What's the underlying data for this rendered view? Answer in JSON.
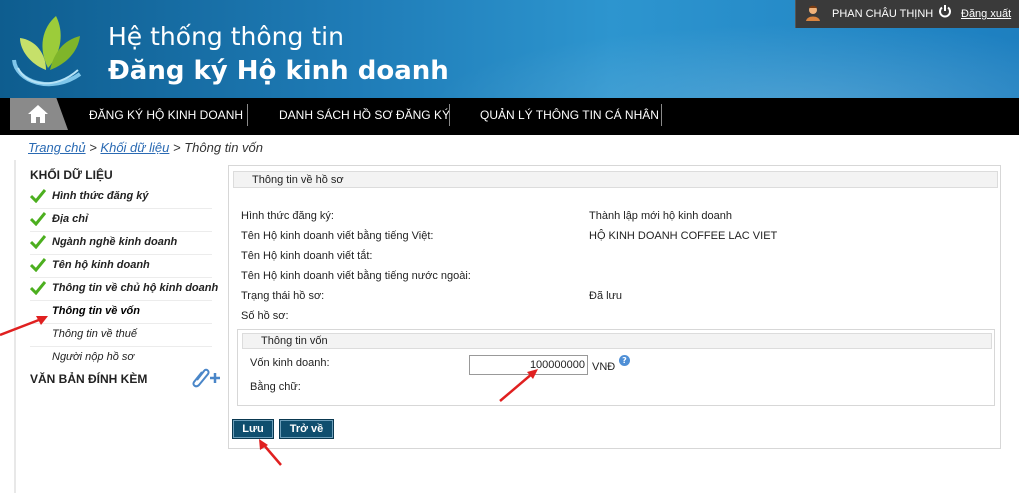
{
  "header": {
    "title_line1": "Hệ thống thông tin",
    "title_line2": "Đăng ký Hộ kinh doanh"
  },
  "user": {
    "name": "PHAN CHÂU THỊNH",
    "logout_label": "Đăng xuất"
  },
  "nav": {
    "items": [
      {
        "label": "ĐĂNG KÝ HỘ KINH DOANH"
      },
      {
        "label": "DANH SÁCH HỒ SƠ ĐĂNG KÝ"
      },
      {
        "label": "QUẢN LÝ THÔNG TIN CÁ NHÂN"
      }
    ]
  },
  "breadcrumb": {
    "home": "Trang chủ",
    "data_block": "Khối dữ liệu",
    "current": "Thông tin vốn",
    "separator": ">"
  },
  "sidebar": {
    "title": "KHỐI DỮ LIỆU",
    "items": [
      {
        "label": "Hình thức đăng ký",
        "checked": true
      },
      {
        "label": "Địa chỉ",
        "checked": true
      },
      {
        "label": "Ngành nghề kinh doanh",
        "checked": true
      },
      {
        "label": "Tên hộ kinh doanh",
        "checked": true
      },
      {
        "label": "Thông tin về chủ hộ kinh doanh",
        "checked": true
      },
      {
        "label": "Thông tin về vốn",
        "checked": false,
        "active": true
      },
      {
        "label": "Thông tin về thuế",
        "checked": false
      },
      {
        "label": "Người nộp hồ sơ",
        "checked": false
      }
    ],
    "attachments_title": "VĂN BẢN ĐÍNH KÈM"
  },
  "profile": {
    "section_title": "Thông tin về hồ sơ",
    "rows": [
      {
        "label": "Hình thức đăng ký:",
        "value": "Thành lập mới hộ kinh doanh"
      },
      {
        "label": "Tên Hộ kinh doanh viết bằng tiếng Việt:",
        "value": "HỘ KINH DOANH COFFEE LAC VIET"
      },
      {
        "label": "Tên Hộ kinh doanh viết tắt:",
        "value": ""
      },
      {
        "label": "Tên Hộ kinh doanh viết bằng tiếng nước ngoài:",
        "value": ""
      },
      {
        "label": "Trạng thái hồ sơ:",
        "value": "Đã lưu"
      },
      {
        "label": "Số hồ sơ:",
        "value": ""
      }
    ]
  },
  "capital": {
    "section_title": "Thông tin vốn",
    "amount_label": "Vốn kinh doanh:",
    "amount_value": "100000000",
    "currency": "VNĐ",
    "in_words_label": "Bằng chữ:",
    "help_glyph": "?"
  },
  "buttons": {
    "save": "Lưu",
    "back": "Trở về"
  },
  "colors": {
    "header_blue": "#1f7cb7",
    "nav_bg": "#000000",
    "button_bg": "#0f4e6e",
    "link": "#2a6ab3",
    "check_green": "#4caf1f",
    "annotation_red": "#e02020"
  }
}
